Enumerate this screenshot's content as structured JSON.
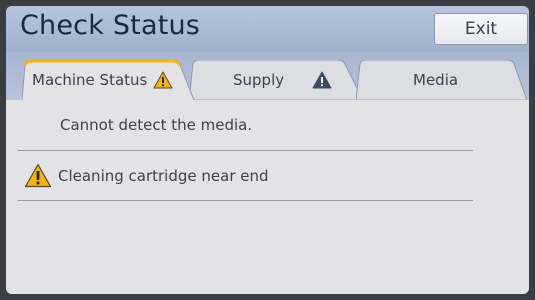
{
  "header": {
    "title": "Check Status",
    "exit_label": "Exit"
  },
  "tabs": [
    {
      "label": "Machine Status",
      "active": true,
      "warning": true
    },
    {
      "label": "Supply",
      "active": false,
      "warning": true
    },
    {
      "label": "Media",
      "active": false,
      "warning": false
    }
  ],
  "messages": [
    {
      "text": "Cannot detect the media.",
      "icon": null
    },
    {
      "text": "Cleaning cartridge near end",
      "icon": "warning-triangle-icon"
    }
  ],
  "colors": {
    "header_bg": "#aab9d4",
    "active_tab_accent": "#f2b21b",
    "warning_fill": "#f2b21b",
    "supply_warning_fill": "#3f4b61",
    "content_bg": "#e3e3e5",
    "title_text": "#1a2740"
  }
}
